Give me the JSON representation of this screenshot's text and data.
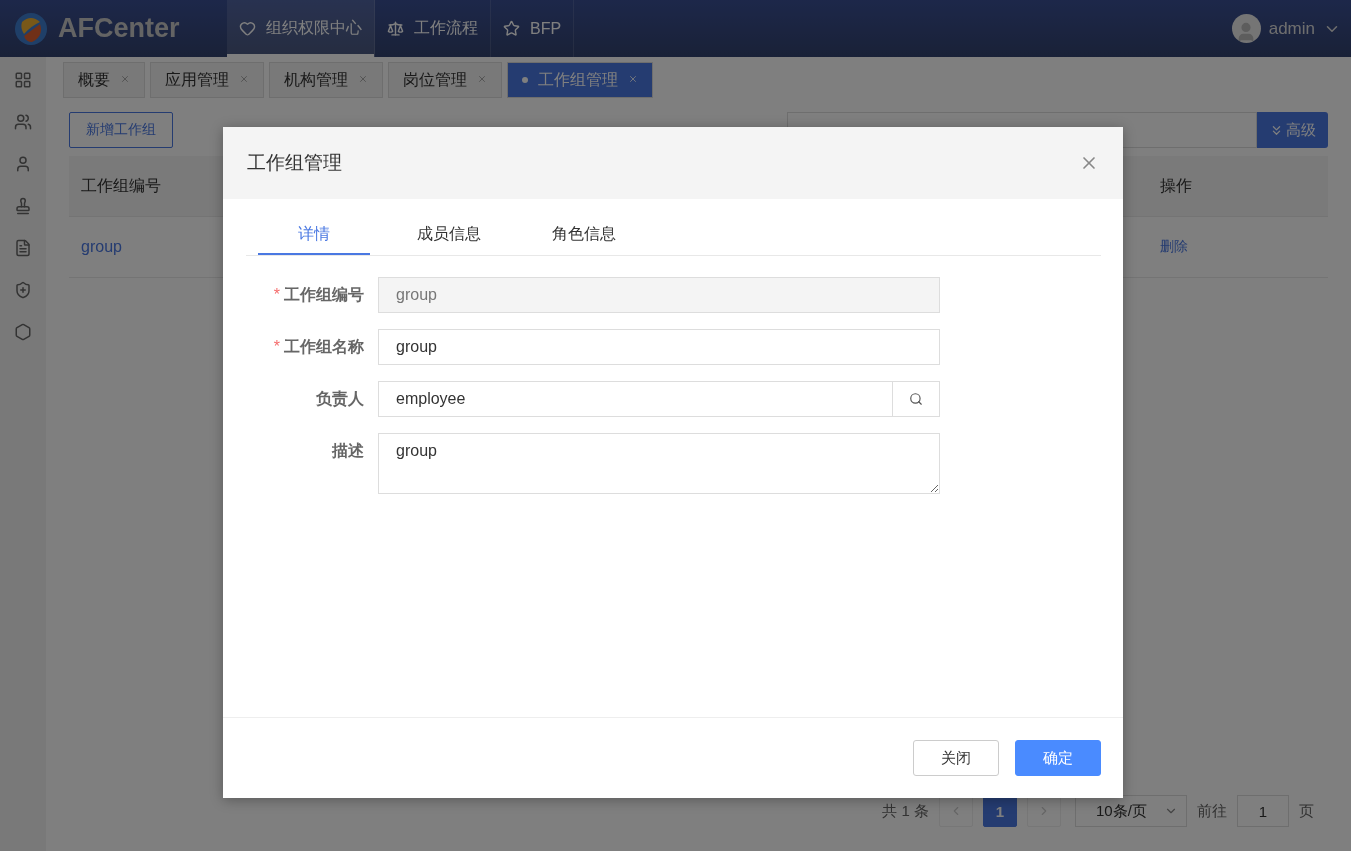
{
  "app": {
    "logo": "AFCenter",
    "user": "admin"
  },
  "top_nav": [
    {
      "label": "组织权限中心",
      "selected": true
    },
    {
      "label": "工作流程",
      "selected": false
    },
    {
      "label": "BFP",
      "selected": false
    }
  ],
  "page_tabs": [
    {
      "label": "概要",
      "selected": false
    },
    {
      "label": "应用管理",
      "selected": false
    },
    {
      "label": "机构管理",
      "selected": false
    },
    {
      "label": "岗位管理",
      "selected": false
    },
    {
      "label": "工作组管理",
      "selected": true
    }
  ],
  "toolbar": {
    "add_button": "新增工作组",
    "advanced_button": "高级"
  },
  "table": {
    "columns": [
      "工作组编号",
      "操作"
    ],
    "rows": [
      {
        "cells": [
          "group",
          "删除"
        ]
      }
    ]
  },
  "pagination": {
    "total": "共 1 条",
    "pages": [
      {
        "label": "1",
        "selected": true
      }
    ],
    "page_size": "10条/页",
    "goto_label": "前往",
    "goto_value": "1",
    "goto_suffix": "页"
  },
  "dialog": {
    "title": "工作组管理",
    "tabs": [
      {
        "label": "详情",
        "selected": true
      },
      {
        "label": "成员信息",
        "selected": false
      },
      {
        "label": "角色信息",
        "selected": false
      }
    ],
    "fields": [
      {
        "label": "工作组编号",
        "kind": "text",
        "required_mark": "*",
        "disabled": true,
        "value": "group"
      },
      {
        "label": "工作组名称",
        "kind": "text",
        "required_mark": "*",
        "disabled": false,
        "value": "group"
      },
      {
        "label": "负责人",
        "kind": "lookup",
        "value": "employee"
      },
      {
        "label": "描述",
        "kind": "textarea",
        "value": "group"
      }
    ],
    "buttons": [
      {
        "label": "关闭",
        "kind": "default"
      },
      {
        "label": "确定",
        "kind": "primary"
      }
    ]
  }
}
